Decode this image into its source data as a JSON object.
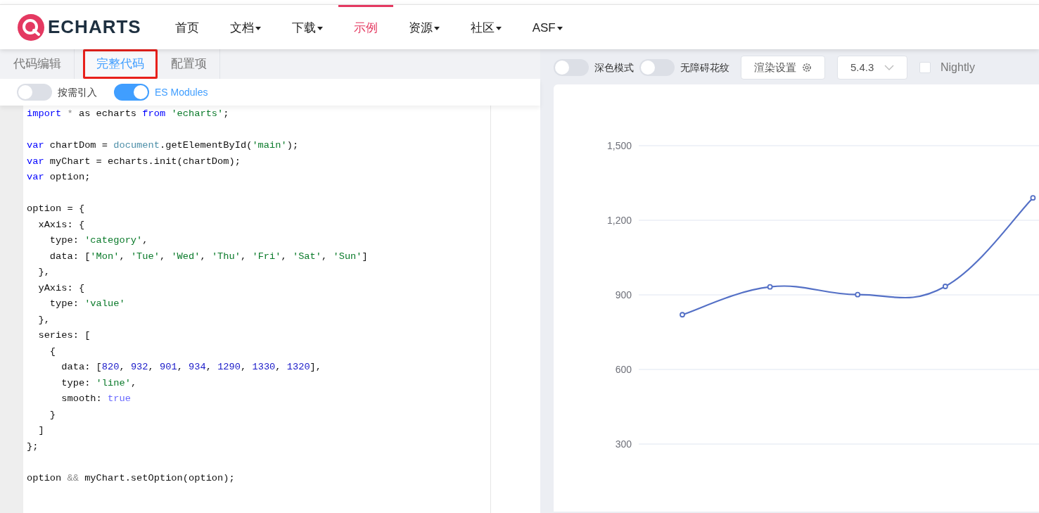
{
  "navbar": {
    "brand": "ECHARTS",
    "items": [
      {
        "label": "首页",
        "dropdown": false,
        "selected": false
      },
      {
        "label": "文档",
        "dropdown": true,
        "selected": false
      },
      {
        "label": "下载",
        "dropdown": true,
        "selected": false
      },
      {
        "label": "示例",
        "dropdown": false,
        "selected": true
      },
      {
        "label": "资源",
        "dropdown": true,
        "selected": false
      },
      {
        "label": "社区",
        "dropdown": true,
        "selected": false
      },
      {
        "label": "ASF",
        "dropdown": true,
        "selected": false
      }
    ]
  },
  "editor": {
    "tabs": [
      {
        "label": "代码编辑",
        "selected": false,
        "highlighted": false
      },
      {
        "label": "完整代码",
        "selected": true,
        "highlighted": true
      },
      {
        "label": "配置项",
        "selected": false,
        "highlighted": false
      }
    ],
    "toggles": [
      {
        "label": "按需引入",
        "on": false
      },
      {
        "label": "ES Modules",
        "on": true
      }
    ],
    "code_lines": [
      {
        "kind": "code",
        "tokens": [
          {
            "text": "import ",
            "kind": "keyword"
          },
          {
            "text": "*",
            "kind": "operator"
          },
          {
            "text": " as echarts ",
            "kind": "plain"
          },
          {
            "text": "from ",
            "kind": "keyword"
          },
          {
            "text": "'echarts'",
            "kind": "string"
          },
          {
            "text": ";",
            "kind": "plain"
          }
        ]
      },
      {
        "kind": "blank"
      },
      {
        "kind": "code",
        "tokens": [
          {
            "text": "var",
            "kind": "keyword"
          },
          {
            "text": " chartDom = ",
            "kind": "plain"
          },
          {
            "text": "document",
            "kind": "builtin"
          },
          {
            "text": ".getElementById(",
            "kind": "plain"
          },
          {
            "text": "'main'",
            "kind": "string"
          },
          {
            "text": ");",
            "kind": "plain"
          }
        ]
      },
      {
        "kind": "code",
        "tokens": [
          {
            "text": "var",
            "kind": "keyword"
          },
          {
            "text": " myChart = echarts.init(chartDom);",
            "kind": "plain"
          }
        ]
      },
      {
        "kind": "code",
        "tokens": [
          {
            "text": "var",
            "kind": "keyword"
          },
          {
            "text": " option;",
            "kind": "plain"
          }
        ]
      },
      {
        "kind": "blank"
      },
      {
        "kind": "code",
        "tokens": [
          {
            "text": "option = {",
            "kind": "plain"
          }
        ]
      },
      {
        "kind": "code",
        "tokens": [
          {
            "text": "  xAxis: {",
            "kind": "plain"
          }
        ]
      },
      {
        "kind": "code",
        "tokens": [
          {
            "text": "    type: ",
            "kind": "plain"
          },
          {
            "text": "'category'",
            "kind": "string"
          },
          {
            "text": ",",
            "kind": "plain"
          }
        ]
      },
      {
        "kind": "code",
        "tokens": [
          {
            "text": "    data: [",
            "kind": "plain"
          },
          {
            "text": "'Mon'",
            "kind": "string"
          },
          {
            "text": ", ",
            "kind": "plain"
          },
          {
            "text": "'Tue'",
            "kind": "string"
          },
          {
            "text": ", ",
            "kind": "plain"
          },
          {
            "text": "'Wed'",
            "kind": "string"
          },
          {
            "text": ", ",
            "kind": "plain"
          },
          {
            "text": "'Thu'",
            "kind": "string"
          },
          {
            "text": ", ",
            "kind": "plain"
          },
          {
            "text": "'Fri'",
            "kind": "string"
          },
          {
            "text": ", ",
            "kind": "plain"
          },
          {
            "text": "'Sat'",
            "kind": "string"
          },
          {
            "text": ", ",
            "kind": "plain"
          },
          {
            "text": "'Sun'",
            "kind": "string"
          },
          {
            "text": "]",
            "kind": "plain"
          }
        ]
      },
      {
        "kind": "code",
        "tokens": [
          {
            "text": "  },",
            "kind": "plain"
          }
        ]
      },
      {
        "kind": "code",
        "tokens": [
          {
            "text": "  yAxis: {",
            "kind": "plain"
          }
        ]
      },
      {
        "kind": "code",
        "tokens": [
          {
            "text": "    type: ",
            "kind": "plain"
          },
          {
            "text": "'value'",
            "kind": "string"
          }
        ]
      },
      {
        "kind": "code",
        "tokens": [
          {
            "text": "  },",
            "kind": "plain"
          }
        ]
      },
      {
        "kind": "code",
        "tokens": [
          {
            "text": "  series: [",
            "kind": "plain"
          }
        ]
      },
      {
        "kind": "code",
        "tokens": [
          {
            "text": "    {",
            "kind": "plain"
          }
        ]
      },
      {
        "kind": "code",
        "tokens": [
          {
            "text": "      data: [",
            "kind": "plain"
          },
          {
            "text": "820",
            "kind": "number"
          },
          {
            "text": ", ",
            "kind": "plain"
          },
          {
            "text": "932",
            "kind": "number"
          },
          {
            "text": ", ",
            "kind": "plain"
          },
          {
            "text": "901",
            "kind": "number"
          },
          {
            "text": ", ",
            "kind": "plain"
          },
          {
            "text": "934",
            "kind": "number"
          },
          {
            "text": ", ",
            "kind": "plain"
          },
          {
            "text": "1290",
            "kind": "number"
          },
          {
            "text": ", ",
            "kind": "plain"
          },
          {
            "text": "1330",
            "kind": "number"
          },
          {
            "text": ", ",
            "kind": "plain"
          },
          {
            "text": "1320",
            "kind": "number"
          },
          {
            "text": "],",
            "kind": "plain"
          }
        ]
      },
      {
        "kind": "code",
        "tokens": [
          {
            "text": "      type: ",
            "kind": "plain"
          },
          {
            "text": "'line'",
            "kind": "string"
          },
          {
            "text": ",",
            "kind": "plain"
          }
        ]
      },
      {
        "kind": "code",
        "tokens": [
          {
            "text": "      smooth: ",
            "kind": "plain"
          },
          {
            "text": "true",
            "kind": "boolean"
          }
        ]
      },
      {
        "kind": "code",
        "tokens": [
          {
            "text": "    }",
            "kind": "plain"
          }
        ]
      },
      {
        "kind": "code",
        "tokens": [
          {
            "text": "  ]",
            "kind": "plain"
          }
        ]
      },
      {
        "kind": "code",
        "tokens": [
          {
            "text": "};",
            "kind": "plain"
          }
        ]
      },
      {
        "kind": "blank"
      },
      {
        "kind": "code",
        "tokens": [
          {
            "text": "option ",
            "kind": "plain"
          },
          {
            "text": "&&",
            "kind": "operator"
          },
          {
            "text": " myChart.setOption(option);",
            "kind": "plain"
          }
        ]
      }
    ]
  },
  "preview": {
    "toggles": [
      {
        "label": "深色模式",
        "on": false
      },
      {
        "label": "无障碍花纹",
        "on": false
      }
    ],
    "render_button": "渲染设置",
    "version_select": {
      "value": "5.4.3"
    },
    "nightly": {
      "label": "Nightly",
      "checked": false
    },
    "chart_data": {
      "type": "line",
      "grid": true,
      "series": [
        {
          "color": "#5470c6",
          "marker": "circle",
          "values": [
            820,
            932,
            901,
            934,
            1290
          ]
        }
      ],
      "ylim": [
        300,
        1500
      ],
      "yticks": [
        {
          "value": 300,
          "label": "300"
        },
        {
          "value": 600,
          "label": "600"
        },
        {
          "value": 900,
          "label": "900"
        },
        {
          "value": 1200,
          "label": "1,200"
        },
        {
          "value": 1500,
          "label": "1,500"
        }
      ]
    }
  }
}
